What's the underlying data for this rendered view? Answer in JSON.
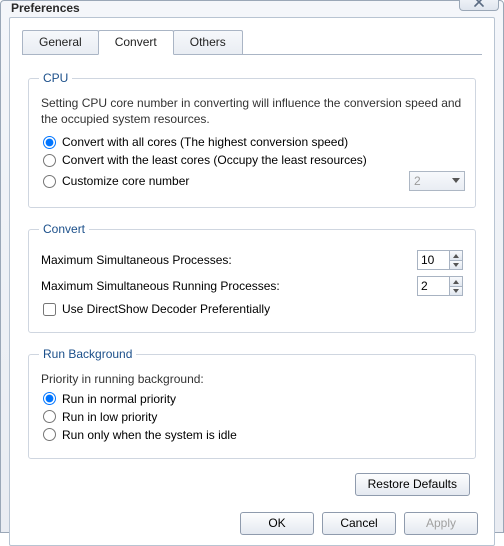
{
  "window": {
    "title": "Preferences"
  },
  "tabs": {
    "general": "General",
    "convert": "Convert",
    "others": "Others"
  },
  "cpu": {
    "legend": "CPU",
    "desc": "Setting CPU core number in converting will influence the conversion speed and the occupied system resources.",
    "opt_all": "Convert with all cores (The highest conversion speed)",
    "opt_least": "Convert with the least cores (Occupy the least resources)",
    "opt_custom": "Customize core number",
    "custom_value": "2"
  },
  "convert": {
    "legend": "Convert",
    "max_proc_label": "Maximum Simultaneous Processes:",
    "max_proc_value": "10",
    "max_run_label": "Maximum Simultaneous Running Processes:",
    "max_run_value": "2",
    "directshow": "Use DirectShow Decoder Preferentially"
  },
  "runbg": {
    "legend": "Run Background",
    "sub": "Priority in running background:",
    "opt_normal": "Run in normal priority",
    "opt_low": "Run in low priority",
    "opt_idle": "Run only when the system is idle"
  },
  "buttons": {
    "restore": "Restore Defaults",
    "ok": "OK",
    "cancel": "Cancel",
    "apply": "Apply"
  }
}
